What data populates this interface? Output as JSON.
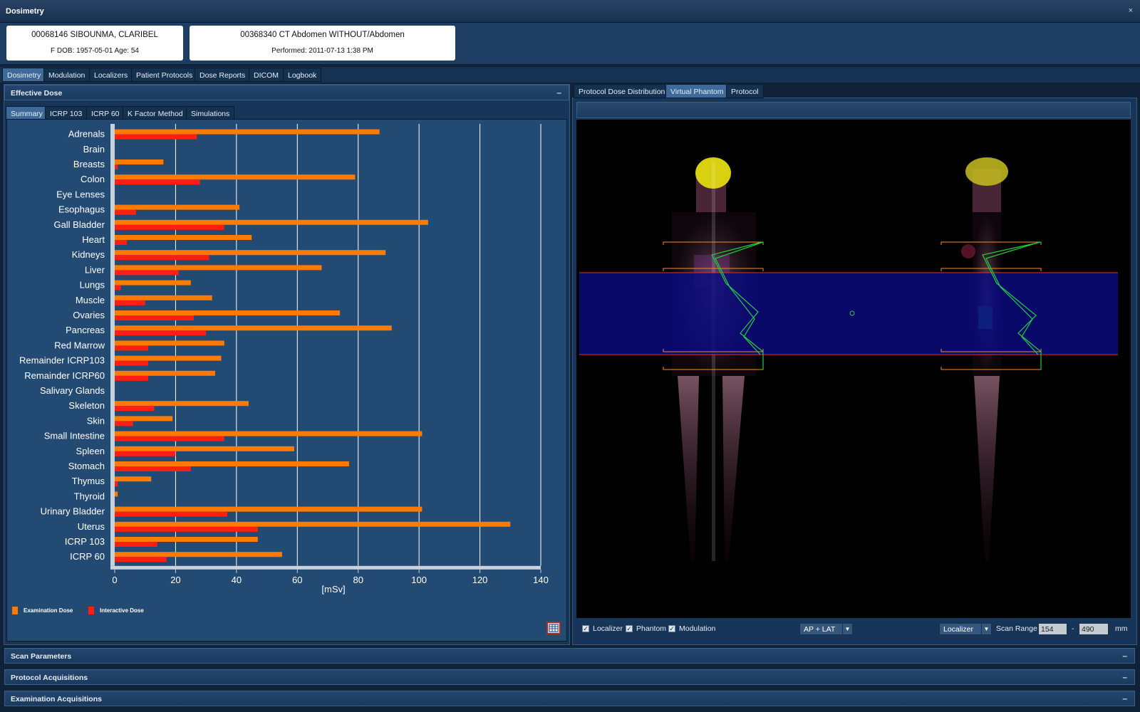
{
  "window": {
    "title": "Dosimetry",
    "close": "×"
  },
  "patient": {
    "line1": "00068146  SIBOUNMA, CLARIBEL",
    "line2": "F  DOB: 1957-05-01  Age: 54"
  },
  "exam": {
    "line1": "00368340 CT Abdomen WITHOUT/Abdomen",
    "line2": "Performed: 2011-07-13 1:38 PM"
  },
  "main_tabs": [
    "Dosimetry",
    "Modulation",
    "Localizers",
    "Patient Protocols",
    "Dose Reports",
    "DICOM",
    "Logbook"
  ],
  "effective_dose": {
    "title": "Effective Dose",
    "minimize": "–",
    "sub_tabs": [
      "Summary",
      "ICRP 103",
      "ICRP 60",
      "K Factor Method",
      "Simulations"
    ]
  },
  "legend": {
    "exam": "Examination Dose",
    "interactive": "Interactive Dose"
  },
  "right_tabs": [
    "Protocol Dose Distribution",
    "Virtual Phantom",
    "Protocol"
  ],
  "viewer_controls": {
    "localizer": "Localizer",
    "phantom": "Phantom",
    "modulation": "Modulation",
    "view_select": "AP + LAT",
    "source_select": "Localizer",
    "scan_range_label": "Scan Range",
    "scan_from": "154",
    "dash": "-",
    "scan_to": "490",
    "unit": "mm"
  },
  "sections": [
    {
      "title": "Scan Parameters",
      "minimize": "–"
    },
    {
      "title": "Protocol Acquisitions",
      "minimize": "–"
    },
    {
      "title": "Examination Acquisitions",
      "minimize": "–"
    }
  ],
  "colors": {
    "exam": "#ff7a00",
    "interactive": "#ff1e12",
    "background": "#173558"
  },
  "chart_data": {
    "type": "bar",
    "orientation": "horizontal",
    "xlabel": "[mSv]",
    "xlim": [
      0,
      140
    ],
    "xticks": [
      0,
      20,
      40,
      60,
      80,
      100,
      120,
      140
    ],
    "grid": true,
    "legend_position": "bottom-left",
    "categories": [
      "Adrenals",
      "Brain",
      "Breasts",
      "Colon",
      "Eye Lenses",
      "Esophagus",
      "Gall Bladder",
      "Heart",
      "Kidneys",
      "Liver",
      "Lungs",
      "Muscle",
      "Ovaries",
      "Pancreas",
      "Red Marrow",
      "Remainder ICRP103",
      "Remainder ICRP60",
      "Salivary Glands",
      "Skeleton",
      "Skin",
      "Small Intestine",
      "Spleen",
      "Stomach",
      "Thymus",
      "Thyroid",
      "Urinary Bladder",
      "Uterus",
      "ICRP 103",
      "ICRP 60"
    ],
    "series": [
      {
        "name": "Examination Dose",
        "values": [
          87,
          0,
          16,
          79,
          0,
          41,
          103,
          45,
          89,
          68,
          25,
          32,
          74,
          91,
          36,
          35,
          33,
          0,
          44,
          19,
          101,
          59,
          77,
          12,
          1,
          101,
          130,
          47,
          55
        ]
      },
      {
        "name": "Interactive Dose",
        "values": [
          27,
          0,
          1,
          28,
          0,
          7,
          36,
          4,
          31,
          21,
          2,
          10,
          26,
          30,
          11,
          11,
          11,
          0,
          13,
          6,
          36,
          20,
          25,
          1,
          0,
          37,
          47,
          14,
          17
        ]
      }
    ]
  }
}
